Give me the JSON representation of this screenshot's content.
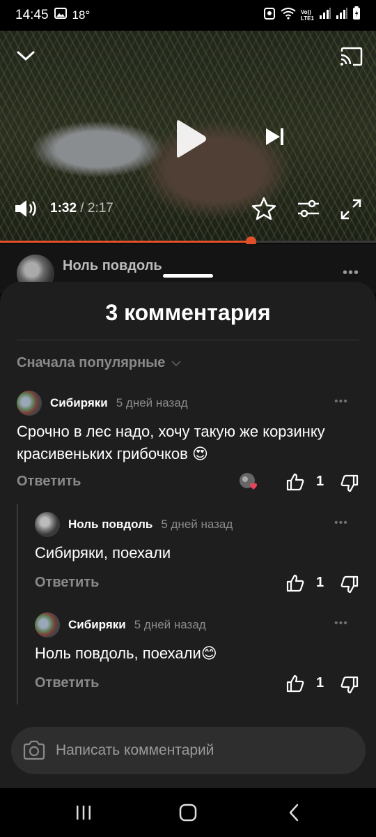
{
  "status_bar": {
    "time": "14:45",
    "temperature": "18°",
    "icons": [
      "gallery-icon",
      "alarm-icon",
      "wifi-icon",
      "volte-icon",
      "signal-icon",
      "signal-icon",
      "battery-icon"
    ],
    "network_label": "Vo)) LTE1"
  },
  "video": {
    "current_time": "1:32",
    "duration": "2:17",
    "separator": " / ",
    "progress_fraction": 0.667,
    "accent_color": "#e0502a",
    "icons": [
      "chevron-down-icon",
      "cast-icon",
      "play-icon",
      "skip-next-icon",
      "volume-icon",
      "star-icon",
      "settings-sliders-icon",
      "fullscreen-icon"
    ]
  },
  "channel": {
    "name": "Ноль повдоль",
    "more": "•••"
  },
  "sheet": {
    "title": "3 комментария",
    "sort_label": "Сначала популярные"
  },
  "comments": [
    {
      "author": "Сибиряки",
      "time": "5 дней назад",
      "text": "Срочно в лес надо, хочу такую же корзинку красивеньких грибочков 😍",
      "reply_label": "Ответить",
      "likes": "1",
      "more": "•••"
    },
    {
      "author": "Ноль повдоль",
      "time": "5 дней назад",
      "text": "Сибиряки, поехали",
      "reply_label": "Ответить",
      "likes": "1",
      "more": "•••"
    },
    {
      "author": "Сибиряки",
      "time": "5 дней назад",
      "text": "Ноль повдоль, поехали😊",
      "reply_label": "Ответить",
      "likes": "1",
      "more": "•••"
    }
  ],
  "composer": {
    "placeholder": "Написать комментарий"
  },
  "nav": {
    "icons": [
      "recent-apps-icon",
      "home-icon",
      "back-icon"
    ]
  }
}
